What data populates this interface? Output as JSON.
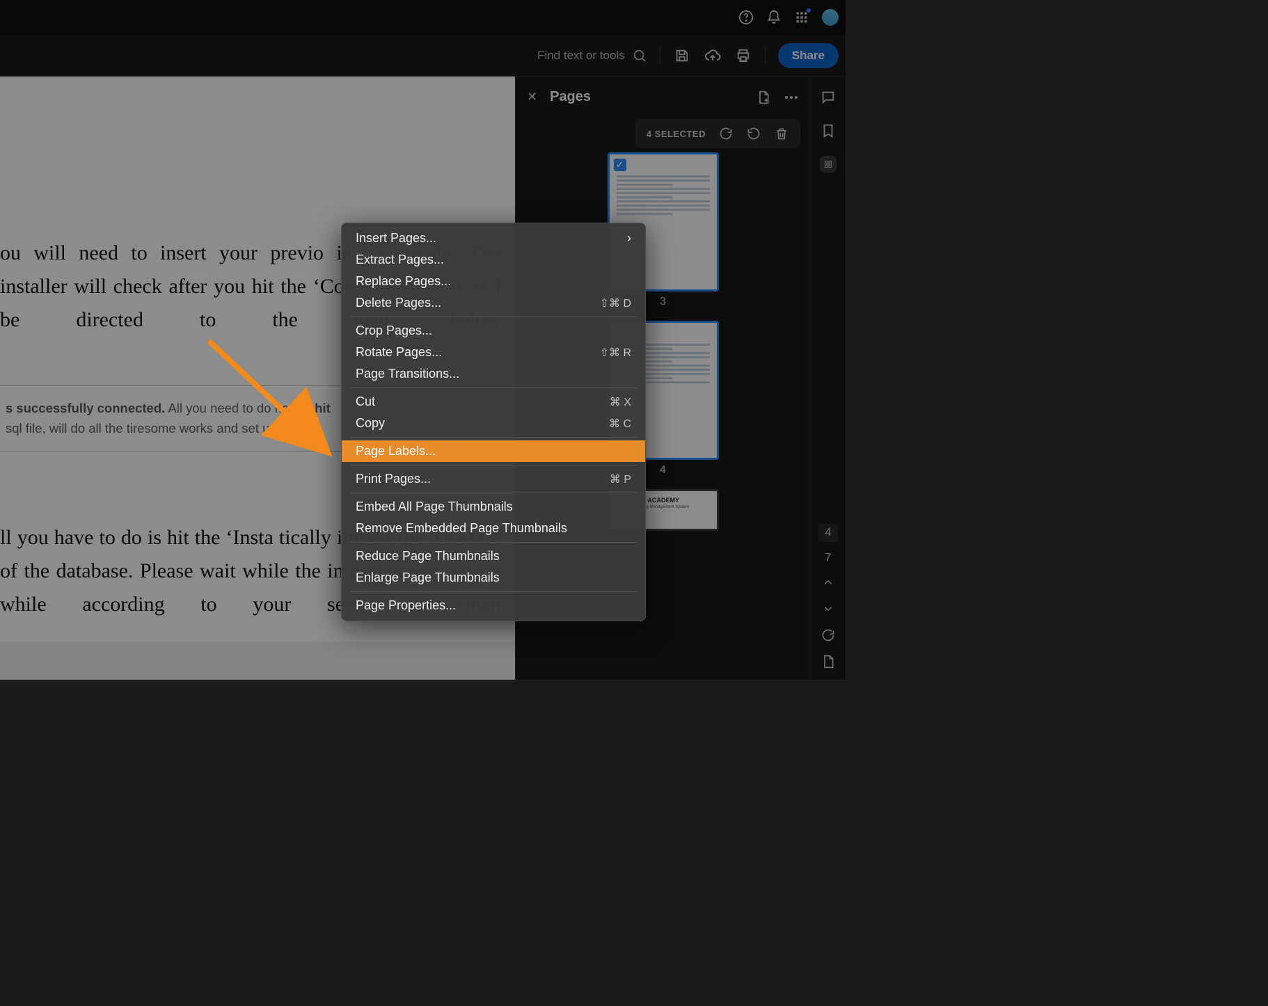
{
  "toolbar": {
    "find_placeholder": "Find text or tools",
    "share_label": "Share"
  },
  "pages_panel": {
    "title": "Pages",
    "selected_label": "4 SELECTED",
    "thumbs": [
      {
        "label": "3"
      },
      {
        "label": "4"
      }
    ]
  },
  "right_rail": {
    "current_page": "4",
    "total_pages": "7"
  },
  "context_menu": {
    "insert_pages": "Insert Pages...",
    "extract_pages": "Extract Pages...",
    "replace_pages": "Replace Pages...",
    "delete_pages": "Delete Pages...",
    "delete_pages_sc": "⇧⌘ D",
    "crop_pages": "Crop Pages...",
    "rotate_pages": "Rotate Pages...",
    "rotate_pages_sc": "⇧⌘ R",
    "page_transitions": "Page Transitions...",
    "cut": "Cut",
    "cut_sc": "⌘ X",
    "copy": "Copy",
    "copy_sc": "⌘ C",
    "page_labels": "Page Labels...",
    "print_pages": "Print Pages...",
    "print_pages_sc": "⌘ P",
    "embed_all": "Embed All Page Thumbnails",
    "remove_embedded": "Remove Embedded Page Thumbnails",
    "reduce_thumbs": "Reduce Page Thumbnails",
    "enlarge_thumbs": "Enlarge Page Thumbnails",
    "page_properties": "Page Properties..."
  },
  "document": {
    "para1": "ou will need to insert your previo ials correctly. The installer will check after you hit the ‘Continue’ button an l be directed to the page below",
    "callout_strong": "s successfully connected.",
    "callout_rest_1": " All you need to do now is ",
    "callout_hit": "hit",
    "callout_line2": "sql file, will do all the tiresome works and set up  our d",
    "para2": "ll you have to do is hit the ‘Insta tically import the database of the database. Please wait while the impo his may take a while according to your server performan"
  },
  "thumb_preview": {
    "t3_heading": "ACADEMY",
    "t3_sub": "d Learning Management System"
  }
}
